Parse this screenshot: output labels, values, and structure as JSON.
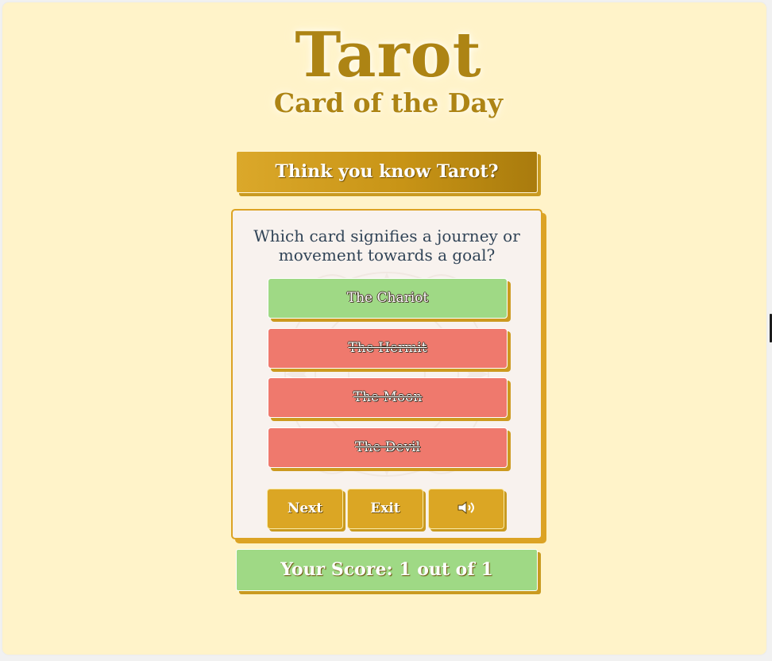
{
  "logo": {
    "title": "Tarot",
    "subtitle": "Card of the Day"
  },
  "banner": {
    "text": "Think you know Tarot?"
  },
  "quiz": {
    "question": "Which card signifies a journey or movement towards a goal?",
    "answers": [
      {
        "label": "The Chariot",
        "status": "correct"
      },
      {
        "label": "The Hermit",
        "status": "incorrect"
      },
      {
        "label": "The Moon",
        "status": "incorrect"
      },
      {
        "label": "The Devil",
        "status": "incorrect"
      }
    ],
    "controls": {
      "next_label": "Next",
      "exit_label": "Exit",
      "sound_icon": "speaker-icon"
    }
  },
  "score": {
    "text": "Your Score: 1 out of 1"
  },
  "colors": {
    "page_background": "#fff3c9",
    "gold": "#dba624",
    "correct": "#9fd985",
    "incorrect": "#ef796d",
    "question_text": "#314457"
  }
}
